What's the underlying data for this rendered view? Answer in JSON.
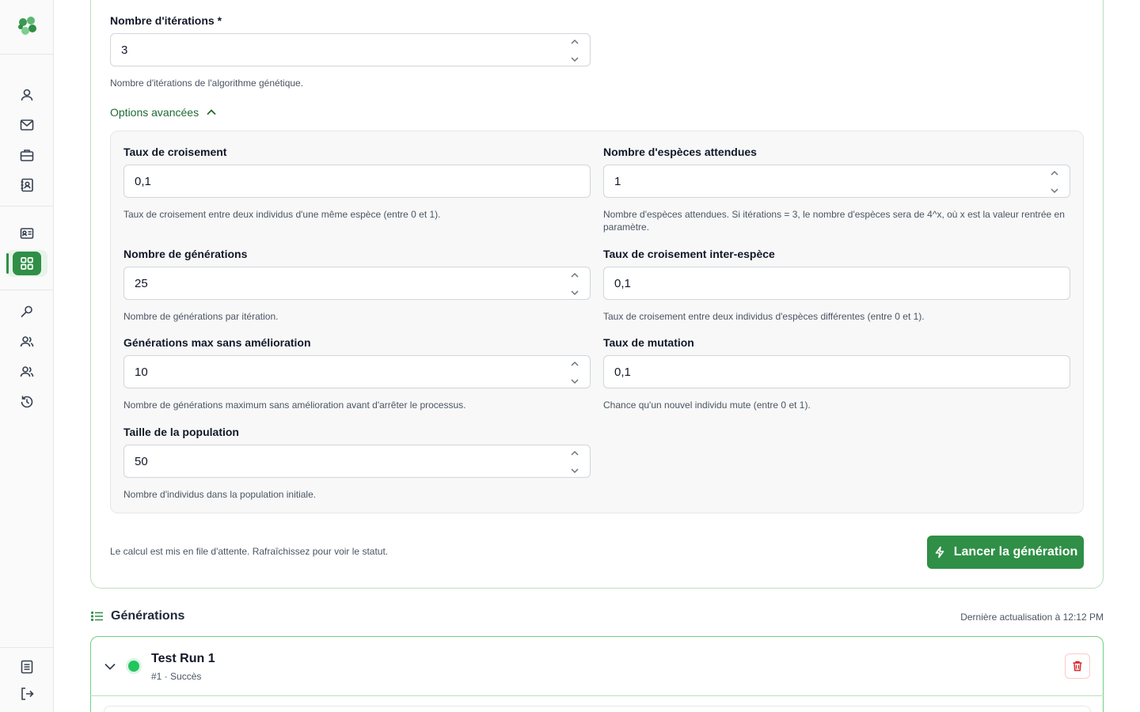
{
  "form": {
    "iterations": {
      "label": "Nombre d'itérations *",
      "value": "3",
      "help": "Nombre d'itérations de l'algorithme génétique."
    },
    "advanced_toggle": "Options avancées",
    "crossover_rate": {
      "label": "Taux de croisement",
      "value": "0,1",
      "help": "Taux de croisement entre deux individus d'une même espèce (entre 0 et 1)."
    },
    "expected_species": {
      "label": "Nombre d'espèces attendues",
      "value": "1",
      "help_line1": "Nombre d'espèces attendues. Si itérations = 3, le nombre d'espèces sera de 4^x, où x est la valeur rentrée en",
      "help_line2": "paramètre."
    },
    "generations": {
      "label": "Nombre de générations",
      "value": "25",
      "help": "Nombre de générations par itération."
    },
    "inter_species_crossover": {
      "label": "Taux de croisement inter-espèce",
      "value": "0,1",
      "help": "Taux de croisement entre deux individus d'espèces différentes (entre 0 et 1)."
    },
    "max_no_improvement": {
      "label": "Générations max sans amélioration",
      "value": "10",
      "help": "Nombre de générations maximum sans amélioration avant d'arrêter le processus."
    },
    "mutation_rate": {
      "label": "Taux de mutation",
      "value": "0,1",
      "help": "Chance qu'un nouvel individu mute (entre 0 et 1)."
    },
    "population_size": {
      "label": "Taille de la population",
      "value": "50",
      "help": "Nombre d'individus dans la population initiale."
    },
    "footnote": "Le calcul est mis en file d'attente. Rafraîchissez pour voir le statut.",
    "launch_label": "Lancer la génération"
  },
  "generations": {
    "title": "Générations",
    "updated": "Dernière actualisation à 12:12 PM",
    "runs": [
      {
        "name": "Test Run 1",
        "meta": "#1 · Succès"
      }
    ]
  },
  "colors": {
    "accent": "#2f8f46",
    "success": "#22c55e",
    "danger": "#dc2626"
  }
}
